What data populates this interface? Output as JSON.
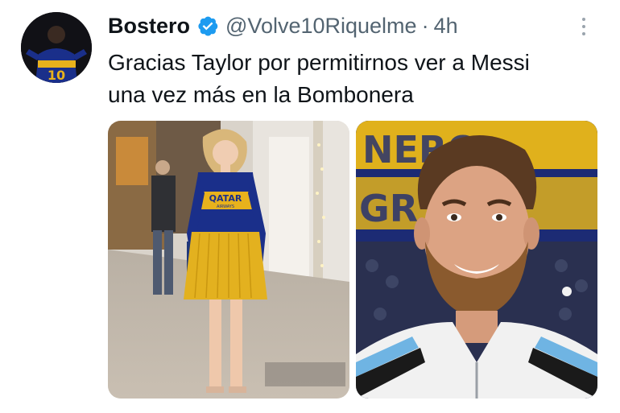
{
  "author": {
    "display_name": "Bostero",
    "handle": "@Volve10Riquelme",
    "separator": "·",
    "time": "4h",
    "avatar_icon": "boca-jersey-avatar",
    "verified_icon": "verified-badge-icon"
  },
  "tweet": {
    "text_line1": "Gracias Taylor por permitirnos ver a Messi",
    "text_line2": "una vez más en la Bombonera"
  },
  "media": [
    {
      "alt_icon": "taylor-boca-jersey-photo",
      "jersey_text": "QATAR",
      "jersey_subtext": "AIRWAYS"
    },
    {
      "alt_icon": "messi-portrait-photo"
    }
  ],
  "colors": {
    "verified": "#1d9bf0",
    "secondary_text": "#536471",
    "boca_blue": "#1a2f8a",
    "boca_yellow": "#e8b21c"
  }
}
